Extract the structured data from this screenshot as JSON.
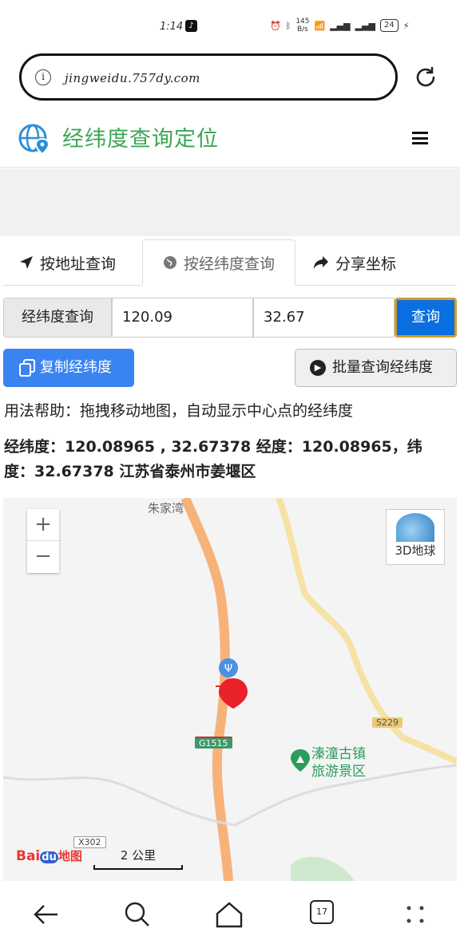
{
  "status": {
    "time": "1:14",
    "speed_value": "145",
    "speed_unit": "B/s",
    "battery": "24"
  },
  "browser": {
    "url": "jingweidu.757dy.com"
  },
  "site": {
    "title": "经纬度查询定位"
  },
  "tabs": [
    {
      "label": "按地址查询",
      "icon": "location-arrow-icon"
    },
    {
      "label": "按经纬度查询",
      "icon": "globe-icon"
    },
    {
      "label": "分享坐标",
      "icon": "share-icon"
    }
  ],
  "query": {
    "label": "经纬度查询",
    "lng": "120.09",
    "lat": "32.67",
    "button": "查询"
  },
  "actions": {
    "copy": "复制经纬度",
    "batch": "批量查询经纬度"
  },
  "help": "用法帮助：拖拽移动地图，自动显示中心点的经纬度",
  "result": "经纬度：120.08965 , 32.67378 经度：120.08965，纬度：32.67378 江苏省泰州市姜堰区",
  "map": {
    "zoom_in": "+",
    "zoom_out": "−",
    "globe_label": "3D地球",
    "place_top": "朱家湾",
    "scenic_line1": "溱潼古镇",
    "scenic_line2": "旅游景区",
    "road_g": "G1515",
    "road_s": "S229",
    "road_x": "X302",
    "logo_bai": "Bai",
    "logo_du": "du",
    "logo_map": "地图",
    "scale": "2 公里"
  },
  "nav": {
    "tab_count": "17"
  },
  "colors": {
    "brand_green": "#3aa655",
    "primary_blue": "#0a6fe0",
    "marker_red": "#e8212b"
  }
}
